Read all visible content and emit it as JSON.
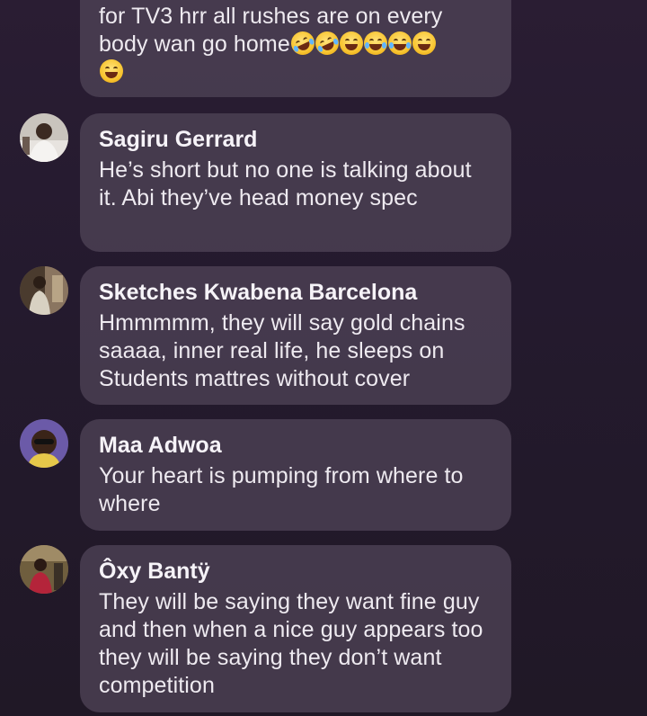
{
  "comments": [
    {
      "author": "",
      "text": "for TV3  hrr all rushes are on every body wan go home",
      "emojis": [
        "rolling-on-floor-laughing",
        "rolling-on-floor-laughing",
        "grinning-sweat",
        "tears-of-joy",
        "tears-of-joy",
        "grinning",
        "laughing"
      ]
    },
    {
      "author": "Sagiru Gerrard",
      "text": "He’s short but no one is talking about it. Abi they’ve head money spec"
    },
    {
      "author": "Sketches Kwabena Barcelona",
      "text": "Hmmmmm, they will say gold chains saaaa, inner real life, he sleeps on Students mattres without cover"
    },
    {
      "author": "Maa Adwoa",
      "text": "Your heart is pumping from where to where"
    },
    {
      "author": "Ôxy Bantÿ",
      "text": "They will be saying they want fine guy and then when a nice guy appears too they will be saying they don’t want competition"
    }
  ],
  "colors": {
    "background": "#261b2e",
    "bubble": "#4e4256",
    "text": "#eeeaf0"
  }
}
